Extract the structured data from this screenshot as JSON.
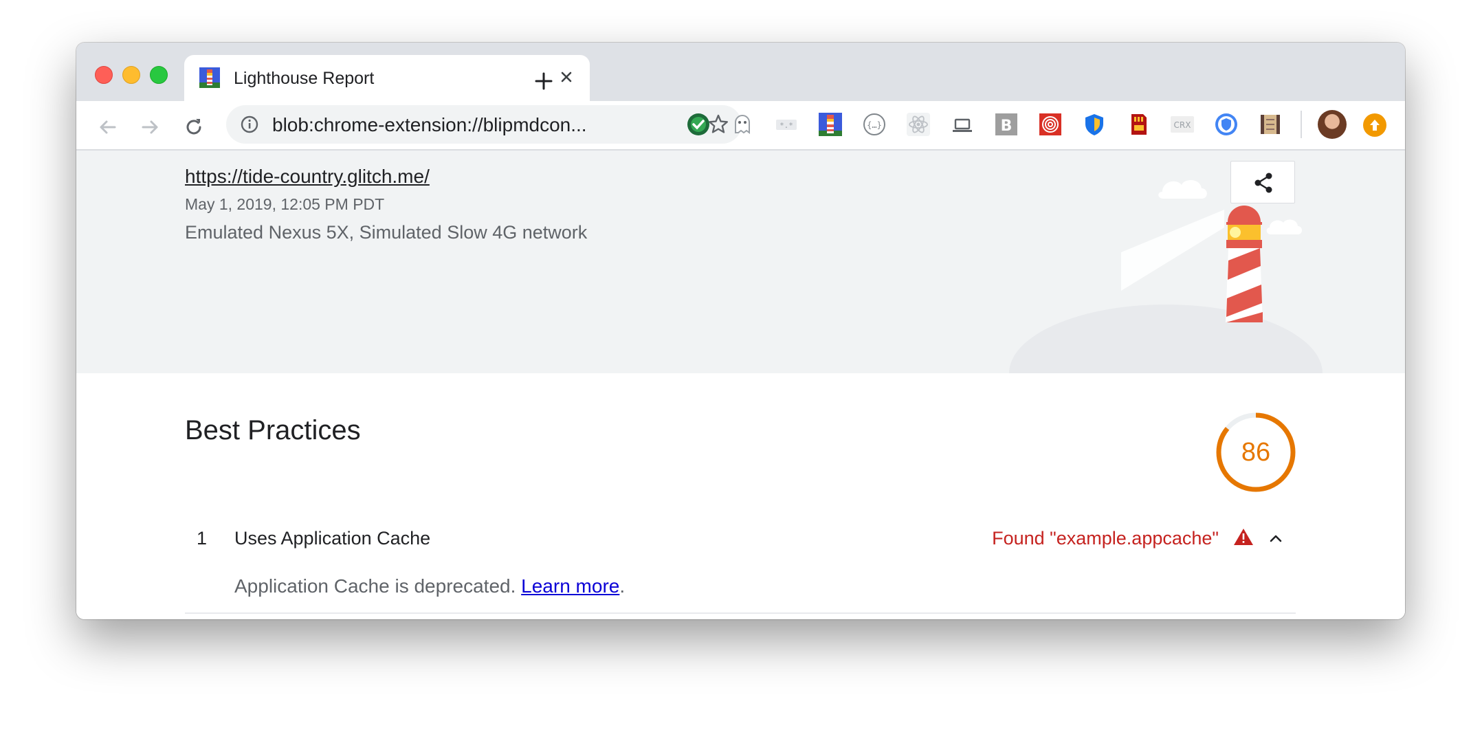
{
  "browser": {
    "tab": {
      "title": "Lighthouse Report"
    },
    "address_bar": {
      "url": "blob:chrome-extension://blipmdcon..."
    },
    "extensions": [
      {
        "icon": "check-shield-extension-icon",
        "color": "#188038"
      },
      {
        "icon": "ghost-extension-icon",
        "color": "#9aa0a6"
      },
      {
        "icon": "regex-extension-icon",
        "color": "#bdc1c6"
      },
      {
        "icon": "lighthouse-extension-icon",
        "color": "#3b5bdb"
      },
      {
        "icon": "json-braces-extension-icon",
        "color": "#80868b"
      },
      {
        "icon": "react-extension-icon",
        "color": "#bdc1c6"
      },
      {
        "icon": "laptop-extension-icon",
        "color": "#5f6368"
      },
      {
        "icon": "b-letter-extension-icon",
        "color": "#9e9e9e"
      },
      {
        "icon": "target-extension-icon",
        "color": "#d93025"
      },
      {
        "icon": "shield-extension-icon",
        "color": "#1a73e8"
      },
      {
        "icon": "sd-card-extension-icon",
        "color": "#b31412"
      },
      {
        "icon": "crx-extension-icon",
        "color": "#9aa0a6"
      },
      {
        "icon": "privacy-badge-extension-icon",
        "color": "#4285f4"
      },
      {
        "icon": "film-extension-icon",
        "color": "#8d6e63"
      }
    ],
    "crx_label": "CRX",
    "b_label": "B"
  },
  "report": {
    "url": "https://tide-country.glitch.me/",
    "date": "May 1, 2019, 12:05 PM PDT",
    "environment": "Emulated Nexus 5X, Simulated Slow 4G network"
  },
  "category": {
    "title": "Best Practices",
    "score": "86",
    "score_fraction": 0.86,
    "score_color": "#e67700"
  },
  "audit": {
    "index": "1",
    "title": "Uses Application Cache",
    "result": "Found \"example.appcache\"",
    "description_prefix": "Application Cache is deprecated. ",
    "learn_more": "Learn more",
    "description_suffix": "."
  },
  "colors": {
    "fail": "#c5221f",
    "link": "#0b00d6",
    "lighthouse_red": "#e2584d",
    "lighthouse_yellow": "#fbc02d"
  }
}
